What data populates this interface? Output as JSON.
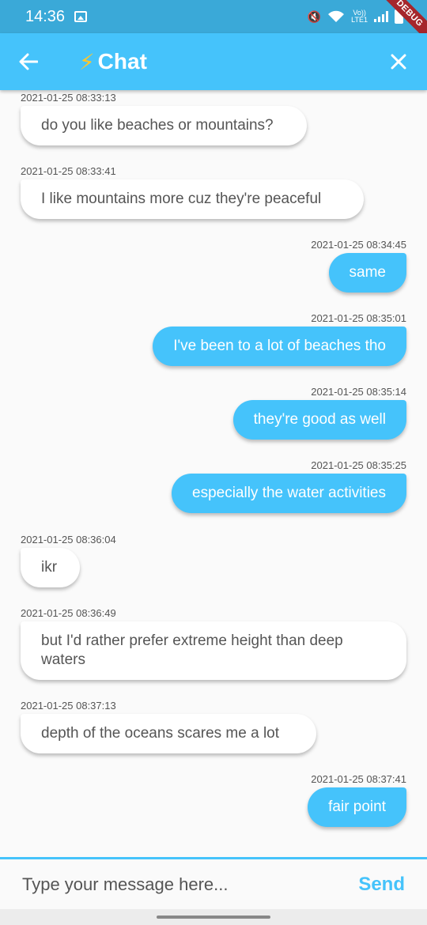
{
  "status_bar": {
    "time": "14:36",
    "network": "LTE1",
    "volte": "Vo))",
    "debug_label": "DEBUG"
  },
  "app_bar": {
    "title": "Chat",
    "bolt_glyph": "⚡",
    "back_icon": "arrow-left-icon",
    "close_icon": "close-icon"
  },
  "messages": [
    {
      "side": "left",
      "timestamp": "2021-01-25 08:33:13",
      "text": "do you like beaches or mountains?"
    },
    {
      "side": "left",
      "timestamp": "2021-01-25 08:33:41",
      "text": "I like mountains more cuz they're peaceful"
    },
    {
      "side": "right",
      "timestamp": "2021-01-25 08:34:45",
      "text": "same"
    },
    {
      "side": "right",
      "timestamp": "2021-01-25 08:35:01",
      "text": "I've been to a lot of beaches tho"
    },
    {
      "side": "right",
      "timestamp": "2021-01-25 08:35:14",
      "text": "they're good as well"
    },
    {
      "side": "right",
      "timestamp": "2021-01-25 08:35:25",
      "text": "especially the water activities"
    },
    {
      "side": "left",
      "timestamp": "2021-01-25 08:36:04",
      "text": "ikr"
    },
    {
      "side": "left",
      "timestamp": "2021-01-25 08:36:49",
      "text": "but I'd rather prefer extreme height than deep waters"
    },
    {
      "side": "left",
      "timestamp": "2021-01-25 08:37:13",
      "text": "depth of the oceans scares me a lot"
    },
    {
      "side": "right",
      "timestamp": "2021-01-25 08:37:41",
      "text": "fair point"
    }
  ],
  "composer": {
    "placeholder": "Type your message here...",
    "send_label": "Send"
  },
  "colors": {
    "accent": "#45c3fb",
    "status_bar": "#3aa9d8",
    "bolt": "#ffc62b"
  }
}
